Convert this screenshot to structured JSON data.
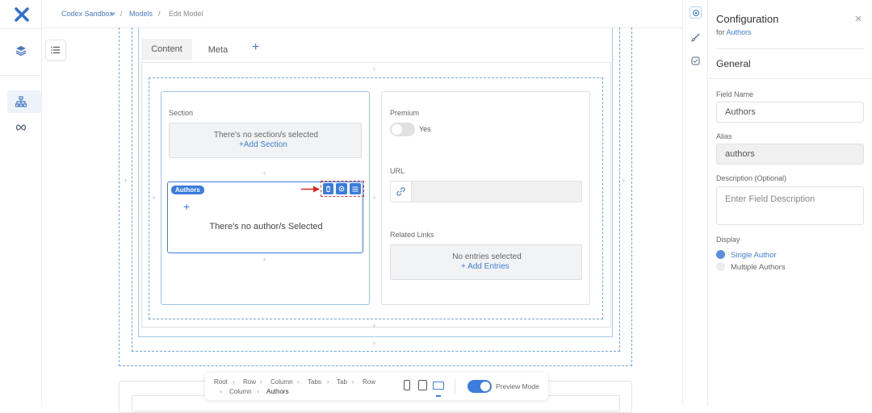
{
  "breadcrumb": {
    "workspace": "Codex Sandbox",
    "models": "Models",
    "current": "Edit Model",
    "sep": "/"
  },
  "tabs": [
    "Content",
    "Meta"
  ],
  "builder": {
    "section": {
      "label": "Section",
      "empty_text": "There's no section/s selected",
      "add_label": "Add Section"
    },
    "authors": {
      "badge": "Authors",
      "empty_text": "There's no author/s Selected"
    },
    "premium": {
      "label": "Premium",
      "toggle_text": "Yes"
    },
    "url": {
      "label": "URL"
    },
    "related": {
      "label": "Related Links",
      "empty_text": "No entries selected",
      "add_label": "Add Entries"
    }
  },
  "path_bar": {
    "items": [
      "Root",
      "Row",
      "Column",
      "Tabs",
      "Tab",
      "Row",
      "Column",
      "Authors"
    ],
    "preview_label": "Preview Mode"
  },
  "config": {
    "title": "Configuration",
    "for_prefix": "for",
    "for_target": "Authors",
    "section_title": "General",
    "field_name_label": "Field Name",
    "field_name_value": "Authors",
    "alias_label": "Alias",
    "alias_value": "authors",
    "description_label": "Description (Optional)",
    "description_placeholder": "Enter Field Description",
    "display_label": "Display",
    "display_options": [
      "Single Author",
      "Multiple Authors"
    ],
    "display_selected": "Single Author"
  },
  "colors": {
    "accent": "#3f7fd0",
    "badge": "#3b7ddd",
    "highlight": "#e02424"
  }
}
